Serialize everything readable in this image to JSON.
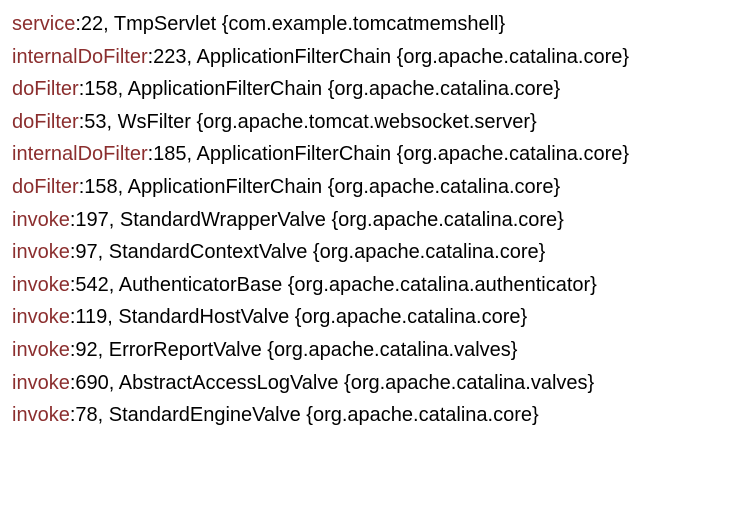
{
  "stack": [
    {
      "method": "service",
      "line": 22,
      "class": "TmpServlet",
      "package": "com.example.tomcatmemshell"
    },
    {
      "method": "internalDoFilter",
      "line": 223,
      "class": "ApplicationFilterChain",
      "package": "org.apache.catalina.core"
    },
    {
      "method": "doFilter",
      "line": 158,
      "class": "ApplicationFilterChain",
      "package": "org.apache.catalina.core"
    },
    {
      "method": "doFilter",
      "line": 53,
      "class": "WsFilter",
      "package": "org.apache.tomcat.websocket.server"
    },
    {
      "method": "internalDoFilter",
      "line": 185,
      "class": "ApplicationFilterChain",
      "package": "org.apache.catalina.core"
    },
    {
      "method": "doFilter",
      "line": 158,
      "class": "ApplicationFilterChain",
      "package": "org.apache.catalina.core"
    },
    {
      "method": "invoke",
      "line": 197,
      "class": "StandardWrapperValve",
      "package": "org.apache.catalina.core"
    },
    {
      "method": "invoke",
      "line": 97,
      "class": "StandardContextValve",
      "package": "org.apache.catalina.core"
    },
    {
      "method": "invoke",
      "line": 542,
      "class": "AuthenticatorBase",
      "package": "org.apache.catalina.authenticator"
    },
    {
      "method": "invoke",
      "line": 119,
      "class": "StandardHostValve",
      "package": "org.apache.catalina.core"
    },
    {
      "method": "invoke",
      "line": 92,
      "class": "ErrorReportValve",
      "package": "org.apache.catalina.valves"
    },
    {
      "method": "invoke",
      "line": 690,
      "class": "AbstractAccessLogValve",
      "package": "org.apache.catalina.valves"
    },
    {
      "method": "invoke",
      "line": 78,
      "class": "StandardEngineValve",
      "package": "org.apache.catalina.core"
    }
  ]
}
